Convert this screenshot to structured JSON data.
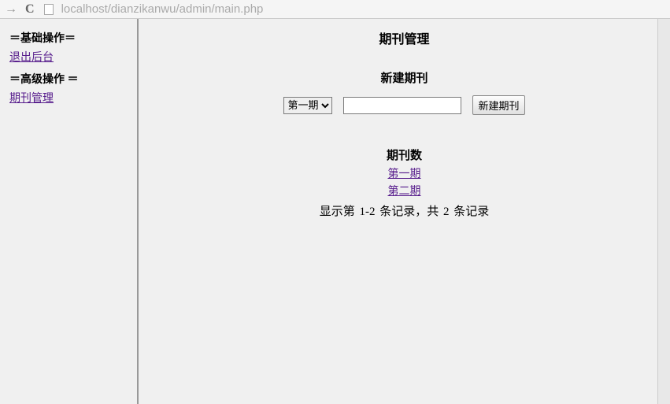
{
  "browser": {
    "url": "localhost/dianzikanwu/admin/main.php"
  },
  "sidebar": {
    "section1_title": "＝基础操作＝",
    "link_logout": "退出后台",
    "section2_title": "＝高级操作 ＝",
    "link_journal": "期刊管理"
  },
  "main": {
    "title": "期刊管理",
    "create_title": "新建期刊",
    "select_options": [
      "第一期"
    ],
    "selected": "第一期",
    "input_value": "",
    "create_button": "新建期刊",
    "count_title": "期刊数",
    "issues": [
      "第一期",
      "第二期"
    ],
    "summary": "显示第 1-2 条记录，共 2 条记录"
  }
}
